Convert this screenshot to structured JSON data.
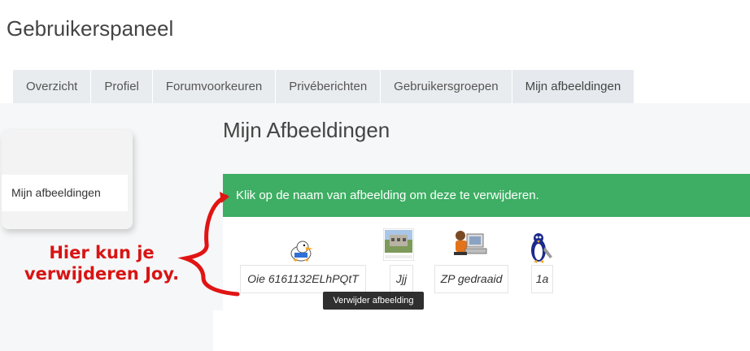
{
  "header": {
    "title": "Gebruikerspaneel"
  },
  "tabs": [
    {
      "label": "Overzicht"
    },
    {
      "label": "Profiel"
    },
    {
      "label": "Forumvoorkeuren"
    },
    {
      "label": "Privéberichten"
    },
    {
      "label": "Gebruikersgroepen"
    },
    {
      "label": "Mijn afbeeldingen",
      "active": true
    }
  ],
  "sidebar": {
    "items": [
      {
        "label": "Mijn afbeeldingen"
      }
    ]
  },
  "main": {
    "title": "Mijn Afbeeldingen",
    "alert": "Klik op de naam van afbeelding om deze te verwijderen.",
    "images": [
      {
        "name": "Oie 6161132ELhPQtT",
        "icon": "duck-icon"
      },
      {
        "name": "Jjj",
        "icon": "building-photo-icon"
      },
      {
        "name": "ZP gedraaid",
        "icon": "person-computer-icon"
      },
      {
        "name": "1a",
        "icon": "penguin-icon"
      }
    ],
    "tooltip": "Verwijder afbeelding"
  },
  "annotation": {
    "text": "Hier kun je verwijderen Joy.",
    "color": "#d81414"
  },
  "colors": {
    "alert_bg": "#3dae63",
    "tab_bg": "#e9ecef"
  }
}
